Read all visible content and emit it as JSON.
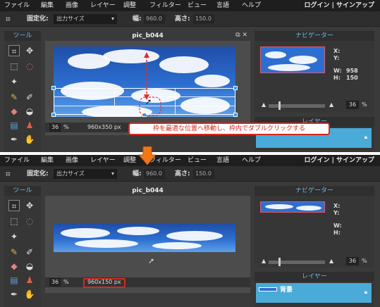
{
  "menu": [
    "ファイル",
    "編集",
    "画像",
    "レイヤー",
    "調整",
    "フィルター",
    "ビュー",
    "言語",
    "ヘルプ"
  ],
  "menu_right": "ログイン | サインアップ",
  "options": {
    "fixed_label": "固定化:",
    "fixed_value": "出力サイズ",
    "width_label": "幅:",
    "width_value": "960.0",
    "height_label": "高さ:",
    "height_value": "150.0"
  },
  "tools_header": "ツール",
  "document": {
    "title": "pic_b044",
    "zoom": "36",
    "percent": "%",
    "size_before": "960x350 px",
    "size_after": "960x150 px"
  },
  "navigator": {
    "header": "ナビゲーター",
    "x_label": "X:",
    "y_label": "Y:",
    "w_label": "W:",
    "h_label": "H:",
    "w_value": "958",
    "h_value": "150",
    "zoom": "36",
    "percent": "%"
  },
  "layers": {
    "header": "レイヤー",
    "layer_name": "背景"
  },
  "annotation": "枠を最適な位置へ移動し、枠内でダブルクリックする",
  "icons": [
    "crop-icon",
    "move-icon",
    "marquee-icon",
    "lasso-icon",
    "wand-icon",
    "pencil-icon",
    "brush-icon",
    "eraser-icon",
    "bucket-icon",
    "gradient-icon",
    "stamp-icon",
    "picker-icon",
    "blur-icon",
    "arrow-down-icon",
    "cursor-icon"
  ],
  "colors": {
    "accent": "#69b9e6",
    "annotation": "#d8281f",
    "layer_bg": "#4aaad8",
    "handle": "#2a9bf0"
  }
}
